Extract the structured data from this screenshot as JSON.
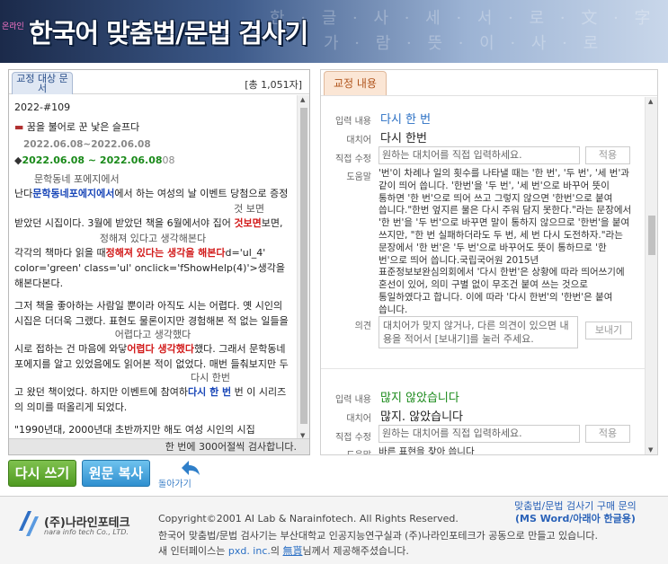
{
  "header": {
    "subtitle": "온라인",
    "title": "한국어 맞춤법/문법 검사기",
    "bg_chars_1": "한 · 글 · 사 · 세 · 서 · 로 · 文 · 字",
    "bg_chars_2": "가 · 람 · 뜻 · 이 · 사 · 로"
  },
  "left_panel": {
    "tab_label": "교정 대상 문서",
    "total": "[총 1,051자]",
    "footer": "한 번에 300어절씩 검사합니다.",
    "lines": {
      "l1": "2022-#109",
      "l2": "꿈을 불어로 꾼 낯은 슬프다",
      "l3_old": "2022.06.08~2022.06.08",
      "l3_new": "2022.06.08 ~ 2022.06.08",
      "l3_tail": "08",
      "l4_ins": "문학동네 포에지에서",
      "l4_a": "난다",
      "l4_b": "문학동네포에지에서",
      "l4_c": "에서 하는 여성의 날 이벤트 당첨으로 증정",
      "l5_ins": "것 보면",
      "l5_a": "받았던 시집이다. 3월에 받았던 책을 6월에서야 집어 ",
      "l5_b": "것보면",
      "l5_c": "보면,",
      "l6_ins": "정해져 있다고 생각해본다",
      "l6_a": "각각의 책마다 읽을 때",
      "l6_b": "정해져 있다는 생각을 해본다",
      "l6_c": "d='ul_4' color='green' class='ul' onclick='fShowHelp(4)'>생각을 해본다본다.",
      "l7": "그저 책을 좋아하는 사람일 뿐이라 아직도 시는 어렵다. 옛 시인의 시집은 더더욱 그랬다. 표현도 물론이지만 경험해본 적 없는 일들을",
      "l8_ins": "어렵다고 생각했다",
      "l8_a": "시로 접하는 건 마음에 와닿",
      "l8_b": "어렵다 생각했다",
      "l8_c": "했다. 그래서 문학동네 포에지를 알고 있었음에도 읽어본 적이 없었다. 매번 들춰보지만 두",
      "l9_ins": "다시 한번",
      "l9_a": "고 왔던 책이었다. 하지만 이벤트에 참여하",
      "l9_b": "다시 한 번",
      "l9_c": " 번 이 시리즈의 의미를 떠올리게 되었다.",
      "l10": "\"1990년대, 2000년대 초반까지만 해도 여성 시인의 시집"
    }
  },
  "right_panel": {
    "tab_label": "교정 내용",
    "labels": {
      "input": "입력 내용",
      "replacement": "대치어",
      "direct": "직접 수정",
      "help": "도움말",
      "opinion": "의견"
    },
    "item1": {
      "input": "다시 한 번",
      "replacement": "다시 한번",
      "direct_placeholder": "원하는 대치어를 직접 입력하세요.",
      "apply": "적용",
      "help": "'번'이 차례나 일의 횟수를 나타낼 때는 '한 번', '두 번', '세 번'과 같이 띄어 씁니다. '한번'을 '두 번', '세 번'으로 바꾸어 뜻이 통하면 '한 번'으로 띄어 쓰고 그렇지 않으면 '한번'으로 붙여 씁니다.\"한번 엎지른 물은 다시 주워 담지 못한다.\"라는 문장에서 '한 번'을 '두 번'으로 바꾸면 말이 통하지 않으므로 '한번'을 붙여 쓰지만, \"한 번 실패하더라도 두 번, 세 번 다시 도전하자.\"라는 문장에서 '한 번'은 '두 번'으로 바꾸어도 뜻이 통하므로 '한 번'으로 띄어 씁니다.국립국어원 2015년 표준정보보완심의회에서 '다시 한번'은 상황에 따라 띄어쓰기에 혼선이 있어, 의미 구별 없이 무조건 붙여 쓰는 것으로 통일하였다고 합니다. 이에 따라 '다시 한번'의 '한번'은 붙여 씁니다.",
      "opinion_placeholder": "대치어가 맞지 않거나, 다른 의견이 있으면 내용을 적어서 [보내기]를 눌러 주세요.",
      "send": "보내기"
    },
    "item2": {
      "input": "많지 않았습니다",
      "replacement": "많지. 않았습니다",
      "direct_placeholder": "원하는 대치어를 직접 입력하세요.",
      "apply": "적용",
      "help": "바른 표현을 찾아 씁니다"
    }
  },
  "actions": {
    "rewrite": "다시 쓰기",
    "copy": "원문 복사",
    "back": "돌아가기"
  },
  "footer": {
    "company_ko": "(주)나라인포테크",
    "company_en": "nara info tech Co., LTD.",
    "copyright": "Copyright©2001 AI Lab & Narainfotech. All Rights Reserved.",
    "line2": "한국어 맞춤법/문법 검사기는 부산대학교 인공지능연구실과 (주)나라인포테크가 공동으로 만들고 있습니다.",
    "line3_a": "새 인터페이스는 ",
    "line3_pxd": "pxd. inc.",
    "line3_b": "의 ",
    "line3_free": "無貰",
    "line3_c": "님께서 제공해주셨습니다.",
    "buy_1": "맞춤법/문법 검사기 구매 문의",
    "buy_2": "(MS Word/아래아 한글용)"
  },
  "colors": {
    "accent_blue": "#2a6fc4",
    "error_red": "#d21b1b",
    "fix_green": "#1a8a1a",
    "rewrite_button": "#5aa82a",
    "copy_button": "#3a9ad8"
  },
  "icons": [
    "speech-icon",
    "back-arrow-icon",
    "company-logo-icon",
    "scroll-up-icon",
    "scroll-down-icon"
  ]
}
